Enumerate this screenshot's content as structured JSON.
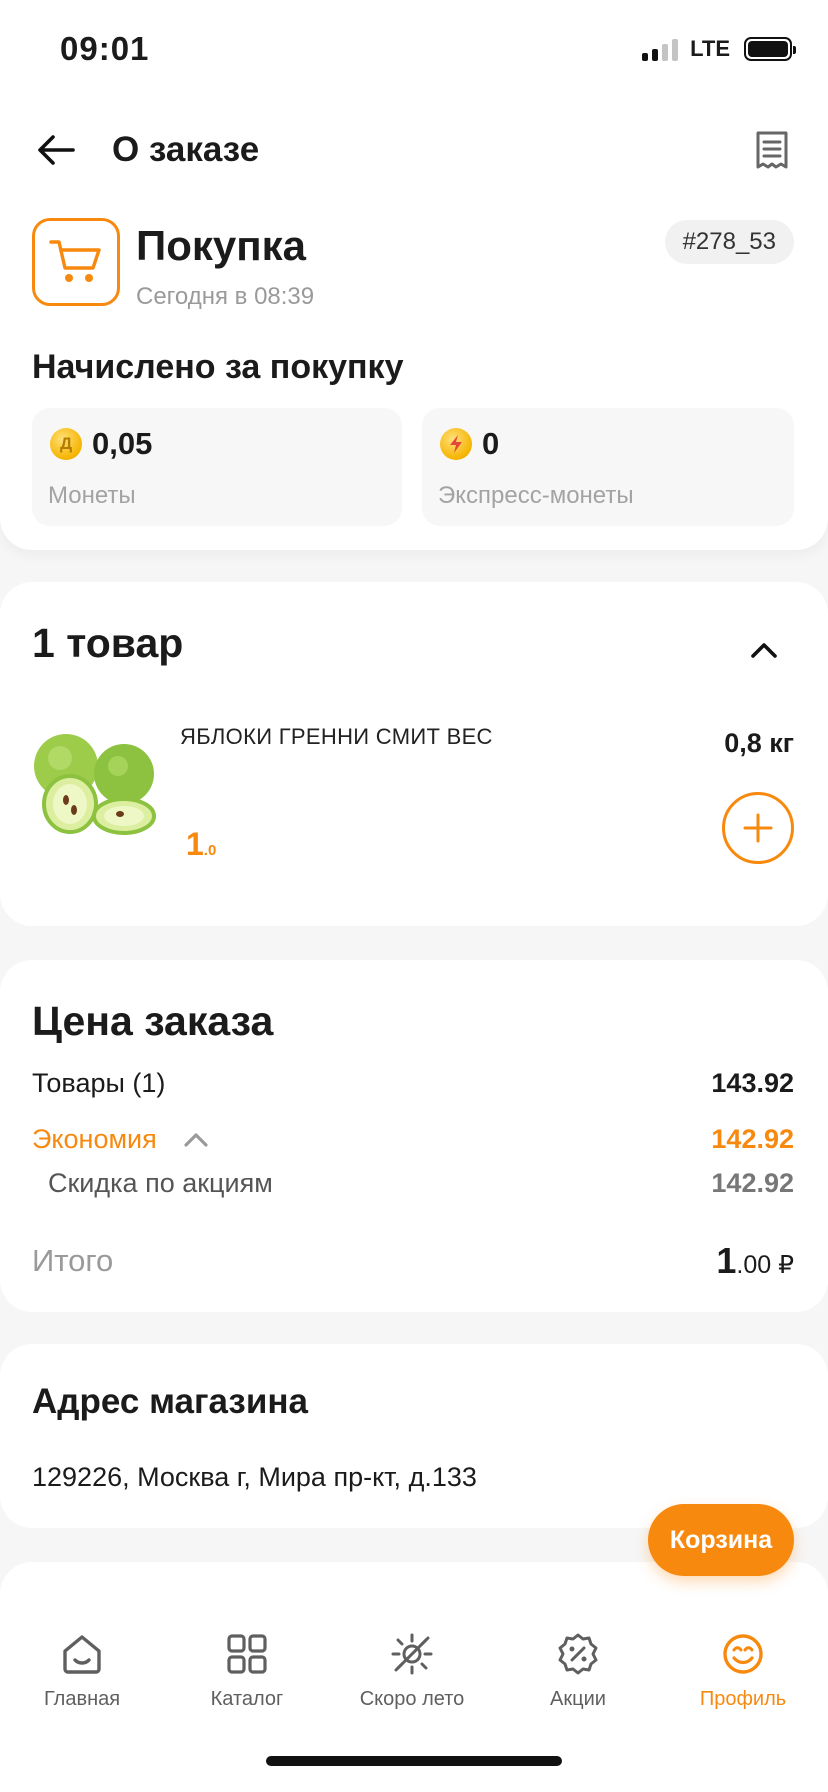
{
  "status_bar": {
    "time": "09:01",
    "network": "LTE"
  },
  "header": {
    "title": "О заказе"
  },
  "purchase": {
    "title": "Покупка",
    "time": "Сегодня в 08:39",
    "order_id": "#278_53",
    "earned_title": "Начислено за покупку",
    "coins": {
      "value": "0,05",
      "label": "Монеты",
      "icon_glyph": "Д"
    },
    "express": {
      "value": "0",
      "label": "Экспресс-монеты"
    }
  },
  "items": {
    "title": "1 товар",
    "product": {
      "name": "ЯБЛОКИ ГРЕННИ СМИТ ВЕС",
      "weight": "0,8 кг",
      "price_major": "1",
      "price_minor": ".0"
    }
  },
  "price": {
    "title": "Цена заказа",
    "goods_label": "Товары (1)",
    "goods_value": "143.92",
    "savings_label": "Экономия",
    "savings_value": "142.92",
    "discount_label": "Скидка по акциям",
    "discount_value": "142.92",
    "total_label": "Итого",
    "total_major": "1",
    "total_minor": ".00 ₽"
  },
  "address": {
    "title": "Адрес магазина",
    "text": "129226, Москва г, Мира пр-кт, д.133"
  },
  "cart_button": {
    "label": "Корзина"
  },
  "tabs": [
    {
      "label": "Главная",
      "icon": "home-icon"
    },
    {
      "label": "Каталог",
      "icon": "grid-icon"
    },
    {
      "label": "Скоро лето",
      "icon": "sun-icon"
    },
    {
      "label": "Акции",
      "icon": "discount-icon"
    },
    {
      "label": "Профиль",
      "icon": "smile-icon",
      "active": true
    }
  ],
  "colors": {
    "accent": "#f7890f",
    "muted": "#9a9a9a",
    "background": "#f6f6f6"
  }
}
